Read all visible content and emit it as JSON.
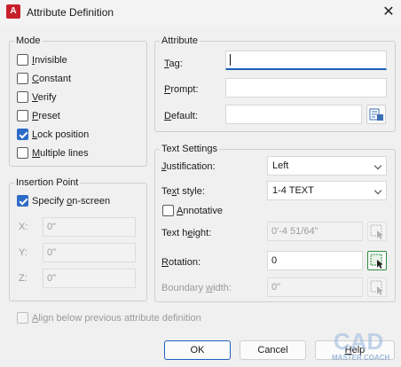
{
  "window": {
    "title": "Attribute Definition",
    "app_icon": "A",
    "close": "✕"
  },
  "mode": {
    "legend": "Mode",
    "items": [
      {
        "label": "Invisible",
        "checked": false
      },
      {
        "label": "Constant",
        "checked": false
      },
      {
        "label": "Verify",
        "checked": false
      },
      {
        "label": "Preset",
        "checked": false
      },
      {
        "label": "Lock position",
        "checked": true
      },
      {
        "label": "Multiple lines",
        "checked": false
      }
    ]
  },
  "insertion": {
    "legend": "Insertion Point",
    "specify_label": "Specify on-screen",
    "specify_checked": true,
    "x_label": "X:",
    "x_value": "0\"",
    "y_label": "Y:",
    "y_value": "0\"",
    "z_label": "Z:",
    "z_value": "0\""
  },
  "attribute": {
    "legend": "Attribute",
    "tag_label": "Tag:",
    "tag_value": "",
    "prompt_label": "Prompt:",
    "prompt_value": "",
    "default_label": "Default:",
    "default_value": ""
  },
  "text_settings": {
    "legend": "Text Settings",
    "justification_label": "Justification:",
    "justification_value": "Left",
    "style_label": "Text style:",
    "style_value": "1-4 TEXT",
    "annotative_label": "Annotative",
    "annotative_checked": false,
    "height_label": "Text height:",
    "height_value": "0'-4 51/64\"",
    "rotation_label": "Rotation:",
    "rotation_value": "0",
    "boundary_label": "Boundary width:",
    "boundary_value": "0\""
  },
  "align_label": "Align below previous attribute definition",
  "buttons": {
    "ok": "OK",
    "cancel": "Cancel",
    "help": "Help"
  },
  "watermark": "CAD MASTER COACH",
  "colors": {
    "accent": "#2d6bc8",
    "icon_red": "#c8202a",
    "pick_green": "#2e8b3e"
  }
}
